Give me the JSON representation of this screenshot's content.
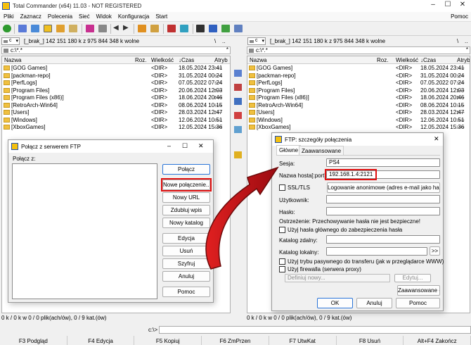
{
  "window": {
    "title": "Total Commander (x64) 11.03 - NOT REGISTERED",
    "minimize": "–",
    "maximize": "☐",
    "close": "✕"
  },
  "menu": [
    "Pliki",
    "Zaznacz",
    "Polecenia",
    "Sieć",
    "Widok",
    "Konfiguracja",
    "Start"
  ],
  "menu_right": "Pomoc",
  "left_panel": {
    "drive": "c",
    "free": "[_brak_]  142 151 180 k z 975 844 348 k wolne",
    "path": "c:\\*.*",
    "path_right_1": "\\",
    "path_right_2": "..",
    "columns": {
      "name": "Nazwa",
      "ext": "Roz.",
      "size": "Wielkość",
      "date": "↓Czas",
      "attr": "Atryb"
    },
    "rows": [
      {
        "name": "[GOG Games]",
        "size": "<DIR>",
        "date": "18.05.2024 23:41",
        "attr": "----"
      },
      {
        "name": "[packman-repo]",
        "size": "<DIR>",
        "date": "31.05.2024 00:24",
        "attr": "----"
      },
      {
        "name": "[PerfLogs]",
        "size": "<DIR>",
        "date": "07.05.2022 07:24",
        "attr": "----"
      },
      {
        "name": "[Program Files]",
        "size": "<DIR>",
        "date": "20.06.2024 12:03",
        "attr": "r---"
      },
      {
        "name": "[Program Files (x86)]",
        "size": "<DIR>",
        "date": "18.06.2024 20:46",
        "attr": "r---"
      },
      {
        "name": "[RetroArch-Win64]",
        "size": "<DIR>",
        "date": "08.06.2024 10:15",
        "attr": "----"
      },
      {
        "name": "[Users]",
        "size": "<DIR>",
        "date": "28.03.2024 12:47",
        "attr": "r---"
      },
      {
        "name": "[Windows]",
        "size": "<DIR>",
        "date": "12.06.2024 10:51",
        "attr": "----"
      },
      {
        "name": "[XboxGames]",
        "size": "<DIR>",
        "date": "12.05.2024 15:36",
        "attr": "----"
      }
    ],
    "status": "0 k / 0 k w 0 / 0 plik(ach/ów), 0 / 9 kat.(ów)"
  },
  "right_panel": {
    "drive": "c",
    "free": "[_brak_]  142 151 180 k z 975 844 348 k wolne",
    "path": "c:\\*.*",
    "path_right_1": "\\",
    "path_right_2": "..",
    "columns": {
      "name": "Nazwa",
      "ext": "Roz.",
      "size": "Wielkość",
      "date": "↓Czas",
      "attr": "Atryb"
    },
    "rows": [
      {
        "name": "[GOG Games]",
        "size": "<DIR>",
        "date": "18.05.2024 23:41",
        "attr": "----"
      },
      {
        "name": "[packman-repo]",
        "size": "<DIR>",
        "date": "31.05.2024 00:24",
        "attr": "----"
      },
      {
        "name": "[PerfLogs]",
        "size": "<DIR>",
        "date": "07.05.2022 07:24",
        "attr": "----"
      },
      {
        "name": "[Program Files]",
        "size": "<DIR>",
        "date": "20.06.2024 12:03",
        "attr": "r---"
      },
      {
        "name": "[Program Files (x86)]",
        "size": "<DIR>",
        "date": "18.06.2024 20:46",
        "attr": "r---"
      },
      {
        "name": "[RetroArch-Win64]",
        "size": "<DIR>",
        "date": "08.06.2024 10:15",
        "attr": "----"
      },
      {
        "name": "[Users]",
        "size": "<DIR>",
        "date": "28.03.2024 12:47",
        "attr": "r---"
      },
      {
        "name": "[Windows]",
        "size": "<DIR>",
        "date": "12.06.2024 10:51",
        "attr": "----"
      },
      {
        "name": "[XboxGames]",
        "size": "<DIR>",
        "date": "12.05.2024 15:36",
        "attr": "----"
      }
    ],
    "status": "0 k / 0 k w 0 / 0 plik(ach/ów), 0 / 9 kat.(ów)"
  },
  "command_line": {
    "label": "c:\\>"
  },
  "fkeys": [
    "F3 Podgląd",
    "F4 Edycja",
    "F5 Kopiuj",
    "F6 ZmPrzen",
    "F7 UtwKat",
    "F8 Usuń",
    "Alt+F4 Zakończ"
  ],
  "ftp_connect": {
    "title": "Połącz z serwerem FTP",
    "label": "Połącz z:",
    "buttons": {
      "connect": "Połącz",
      "new_connection": "Nowe połączenie...",
      "new_url": "Nowy URL",
      "duplicate": "Zdubluj wpis",
      "new_folder": "Nowy katalog",
      "edit": "Edycja",
      "delete": "Usuń",
      "encrypt": "Szyfruj",
      "cancel": "Anuluj",
      "help": "Pomoc"
    }
  },
  "ftp_details": {
    "title": "FTP: szczegóły połączenia",
    "tabs": [
      "Główne",
      "Zaawansowane"
    ],
    "session_label": "Sesja:",
    "session_value": "PS4",
    "host_label": "Nazwa hosta[:port]:",
    "host_value": "192.168.1.4:2121",
    "ssl_label": "SSL/TLS",
    "anon_button": "Logowanie anonimowe (adres e-mail jako hasło)",
    "user_label": "Użytkownik:",
    "password_label": "Hasło:",
    "warning": "Ostrzeżenie: Przechowywanie hasła nie jest bezpieczne!",
    "master_pw_label": "Użyj hasła głównego do zabezpieczenia hasła",
    "remote_dir_label": "Katalog zdalny:",
    "local_dir_label": "Katalog lokalny:",
    "browse_button": ">>",
    "passive_label": "Użyj trybu pasywnego do transferu (jak w przeglądarce WWW)",
    "firewall_label": "Użyj firewalla (serwera proxy)",
    "firewall_select": "Definiuj nowy...",
    "firewall_edit": "Edytuj...",
    "advanced_button": "Zaawansowane ->",
    "ok_button": "OK",
    "cancel_button": "Anuluj",
    "help_button": "Pomoc"
  },
  "colors": {
    "highlight": "#e01010",
    "arrow": "#c8101a",
    "folder": "#f0c040",
    "primary_border": "#2a74d8"
  }
}
